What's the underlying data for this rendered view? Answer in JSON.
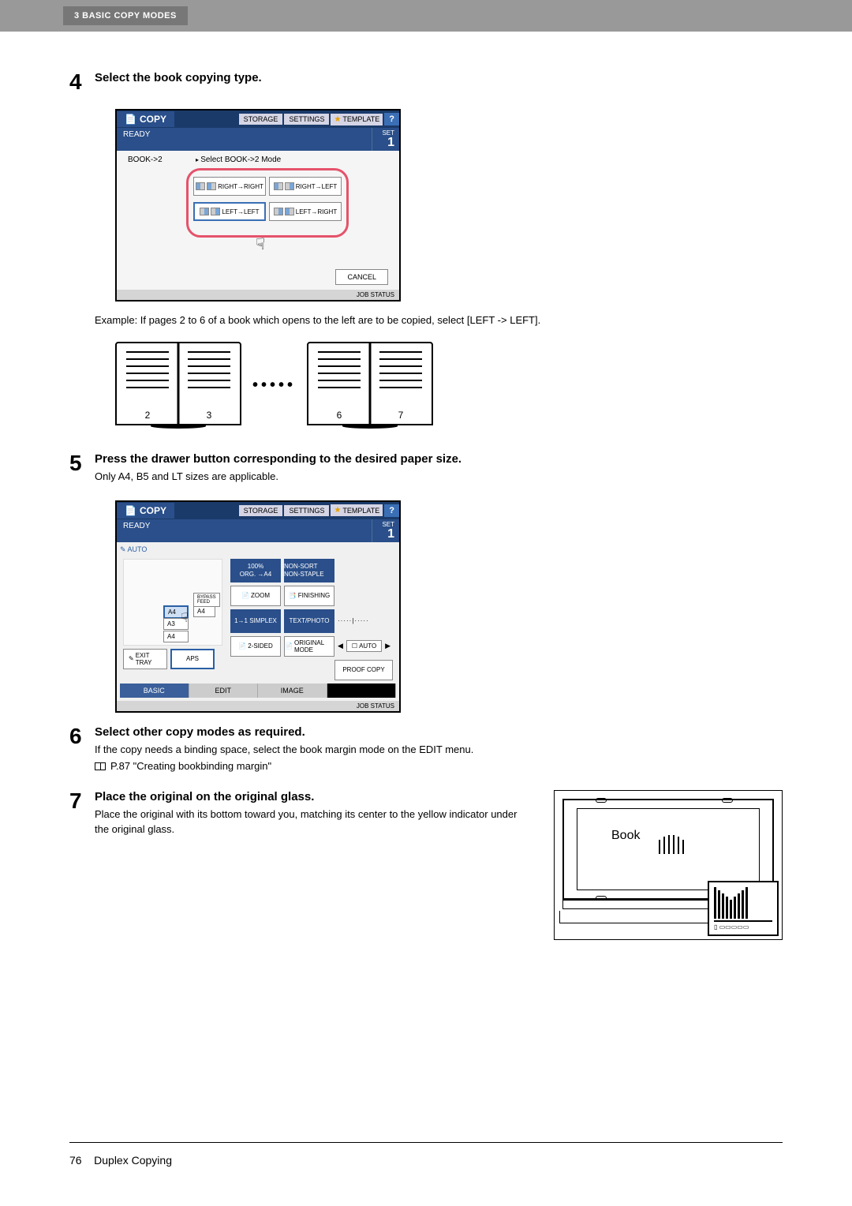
{
  "header": {
    "chapter": "3  BASIC COPY MODES"
  },
  "step4": {
    "num": "4",
    "title": "Select the book copying type."
  },
  "panel1": {
    "copy_tab": "COPY",
    "storage": "STORAGE",
    "settings": "SETTINGS",
    "template": "TEMPLATE",
    "help": "?",
    "ready": "READY",
    "set_label": "SET",
    "set_num": "1",
    "mode_label": "BOOK->2",
    "prompt": "Select BOOK->2 Mode",
    "btn_rr": "RIGHT→RIGHT",
    "btn_rl": "RIGHT→LEFT",
    "btn_ll": "LEFT→LEFT",
    "btn_lr": "LEFT→RIGHT",
    "cancel": "CANCEL",
    "job_status": "JOB STATUS"
  },
  "example_text": "Example: If pages 2 to 6 of a book which opens to the left are to be copied, select [LEFT -> LEFT].",
  "diagram_pages": {
    "p2": "2",
    "p3": "3",
    "p6": "6",
    "p7": "7"
  },
  "step5": {
    "num": "5",
    "title": "Press the drawer button corresponding to the desired paper size.",
    "sub": "Only A4, B5 and LT sizes are applicable."
  },
  "panel2": {
    "auto": "AUTO",
    "bypass": "BYPASS FEED",
    "a4": "A4",
    "a3": "A3",
    "a4b": "A4",
    "exit_tray": "EXIT TRAY",
    "aps": "APS",
    "zoom_pct": "100%",
    "org": "ORG. →A4",
    "zoom": "ZOOM",
    "nonsort": "NON-SORT NON-STAPLE",
    "finishing": "FINISHING",
    "simplex": "1→1 SIMPLEX",
    "twosided": "2-SIDED",
    "textphoto": "TEXT/PHOTO",
    "original": "ORIGINAL MODE",
    "autoexp": "AUTO",
    "proof": "PROOF COPY",
    "tabs": {
      "basic": "BASIC",
      "edit": "EDIT",
      "image": "IMAGE"
    }
  },
  "step6": {
    "num": "6",
    "title": "Select other copy modes as required.",
    "sub": "If the copy needs a binding space, select the book margin mode on the EDIT menu.",
    "ref": "P.87 \"Creating bookbinding margin\""
  },
  "step7": {
    "num": "7",
    "title": "Place the original on the original glass.",
    "sub": "Place the original with its bottom toward you, matching its center to the yellow indicator under the original glass.",
    "book_label": "Book"
  },
  "footer": {
    "page": "76",
    "section": "Duplex Copying"
  }
}
